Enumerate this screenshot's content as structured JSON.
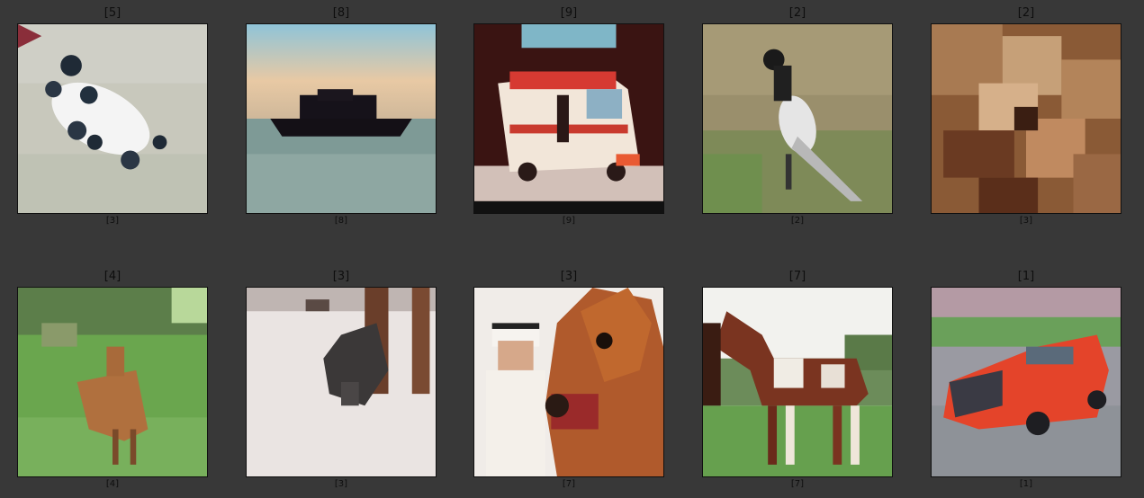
{
  "figure": {
    "background": "#383838",
    "text_color": "#0e0e0e"
  },
  "cells": [
    {
      "true_label": "[5]",
      "pred_label": "[3]",
      "image": "dog-image"
    },
    {
      "true_label": "[8]",
      "pred_label": "[8]",
      "image": "ship-image"
    },
    {
      "true_label": "[9]",
      "pred_label": "[9]",
      "image": "truck-image"
    },
    {
      "true_label": "[2]",
      "pred_label": "[2]",
      "image": "bird-image"
    },
    {
      "true_label": "[2]",
      "pred_label": "[3]",
      "image": "bird-closeup-image"
    },
    {
      "true_label": "[4]",
      "pred_label": "[4]",
      "image": "deer-image"
    },
    {
      "true_label": "[3]",
      "pred_label": "[3]",
      "image": "cat-image"
    },
    {
      "true_label": "[3]",
      "pred_label": "[7]",
      "image": "horse-with-man-image"
    },
    {
      "true_label": "[7]",
      "pred_label": "[7]",
      "image": "horse-image"
    },
    {
      "true_label": "[1]",
      "pred_label": "[1]",
      "image": "car-image"
    }
  ]
}
